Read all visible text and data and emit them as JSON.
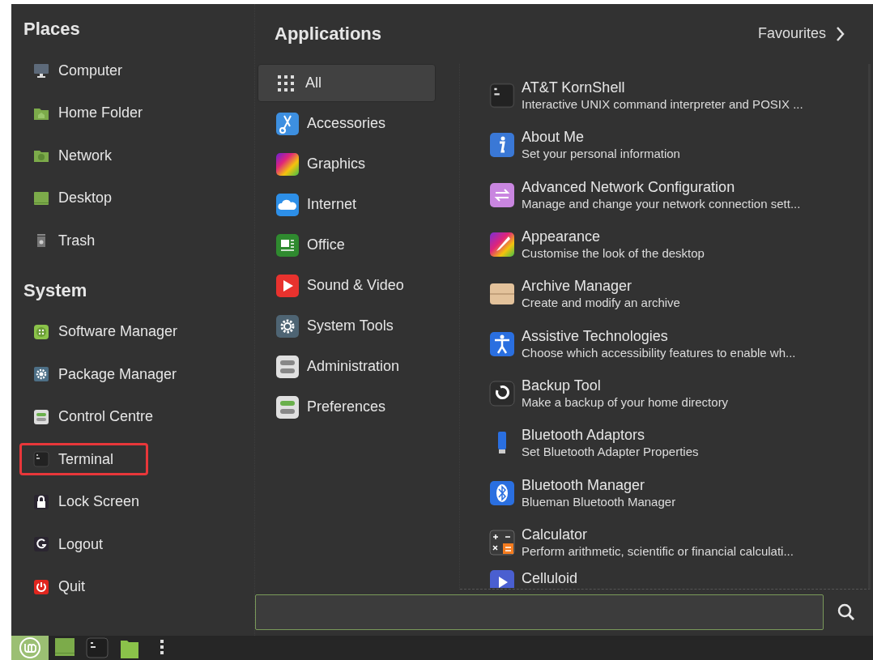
{
  "places": {
    "title": "Places",
    "items": [
      {
        "label": "Computer"
      },
      {
        "label": "Home Folder"
      },
      {
        "label": "Network"
      },
      {
        "label": "Desktop"
      },
      {
        "label": "Trash"
      }
    ]
  },
  "system": {
    "title": "System",
    "items": [
      {
        "label": "Software Manager",
        "highlighted": false
      },
      {
        "label": "Package Manager",
        "highlighted": false
      },
      {
        "label": "Control Centre",
        "highlighted": false
      },
      {
        "label": "Terminal",
        "highlighted": true
      },
      {
        "label": "Lock Screen",
        "highlighted": false
      },
      {
        "label": "Logout",
        "highlighted": false
      },
      {
        "label": "Quit",
        "highlighted": false
      }
    ]
  },
  "applications": {
    "title": "Applications",
    "favourites": "Favourites",
    "categories": [
      {
        "label": "All",
        "selected": true
      },
      {
        "label": "Accessories",
        "selected": false
      },
      {
        "label": "Graphics",
        "selected": false
      },
      {
        "label": "Internet",
        "selected": false
      },
      {
        "label": "Office",
        "selected": false
      },
      {
        "label": "Sound & Video",
        "selected": false
      },
      {
        "label": "System Tools",
        "selected": false
      },
      {
        "label": "Administration",
        "selected": false
      },
      {
        "label": "Preferences",
        "selected": false
      }
    ],
    "apps": [
      {
        "name": "AT&T KornShell",
        "description": "Interactive UNIX command interpreter and POSIX ..."
      },
      {
        "name": "About Me",
        "description": "Set your personal information"
      },
      {
        "name": "Advanced Network Configuration",
        "description": "Manage and change your network connection sett..."
      },
      {
        "name": "Appearance",
        "description": "Customise the look of the desktop"
      },
      {
        "name": "Archive Manager",
        "description": "Create and modify an archive"
      },
      {
        "name": "Assistive Technologies",
        "description": "Choose which accessibility features to enable wh..."
      },
      {
        "name": "Backup Tool",
        "description": "Make a backup of your home directory"
      },
      {
        "name": "Bluetooth Adaptors",
        "description": "Set Bluetooth Adapter Properties"
      },
      {
        "name": "Bluetooth Manager",
        "description": "Blueman Bluetooth Manager"
      },
      {
        "name": "Calculator",
        "description": "Perform arithmetic, scientific or financial calculati..."
      },
      {
        "name": "Celluloid"
      }
    ]
  },
  "taskbar": {
    "items": [
      {
        "selected": true
      },
      {
        "selected": false
      },
      {
        "selected": false
      },
      {
        "selected": false
      },
      {
        "selected": false
      }
    ]
  }
}
